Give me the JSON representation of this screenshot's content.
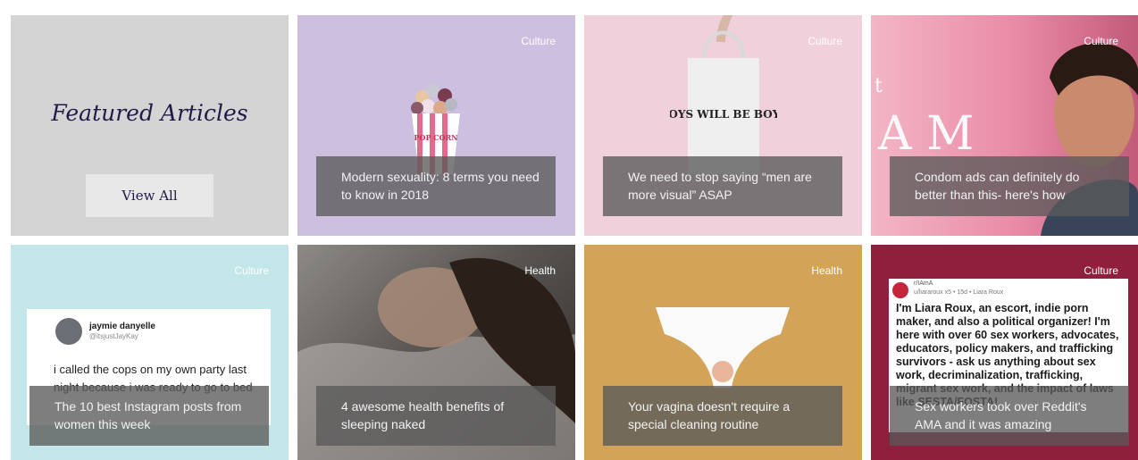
{
  "featured": {
    "title": "Featured Articles",
    "view_all_label": "View All"
  },
  "articles": [
    {
      "tag": "Culture",
      "caption": "Modern sexuality: 8 terms you need to know in 2018"
    },
    {
      "tag": "Culture",
      "caption": "We need to stop saying “men are more visual” ASAP"
    },
    {
      "tag": "Culture",
      "caption": "Condom ads can definitely do better than this- here's how"
    },
    {
      "tag": "Culture",
      "caption": "The 10 best Instagram posts from women this week"
    },
    {
      "tag": "Health",
      "caption": "4 awesome health benefits of sleeping naked"
    },
    {
      "tag": "Health",
      "caption": "Your vagina doesn't require a special cleaning routine"
    },
    {
      "tag": "Culture",
      "caption": "Sex workers took over Reddit's AMA and it was amazing"
    }
  ],
  "images": {
    "popcorn_box_text": "POP CORN",
    "tote_text": "BOYS WILL BE BOYS",
    "condom_ad_text": "A M",
    "condom_ad_letter": "t",
    "tweet": {
      "name": "jaymie danyelle",
      "handle": "@itsjustJayKay",
      "text": "i called the cops on my own party last night because i was ready to go to bed"
    },
    "reddit": {
      "subreddit": "r/IAmA",
      "meta": "u/liararoux  x5 • 15d • Liara Roux",
      "text": "I'm Liara Roux, an escort, indie porn maker, and also a political organizer! I'm here with over 60 sex workers, advocates, educators, policy makers, and trafficking survivors - ask us anything about sex work, decriminalization, trafficking, migrant sex work, and the impact of laws like SESTA/FOSTA!"
    }
  },
  "colors": {
    "featured_text": "#231a4a",
    "caption_overlay": "#5a5a5a"
  }
}
